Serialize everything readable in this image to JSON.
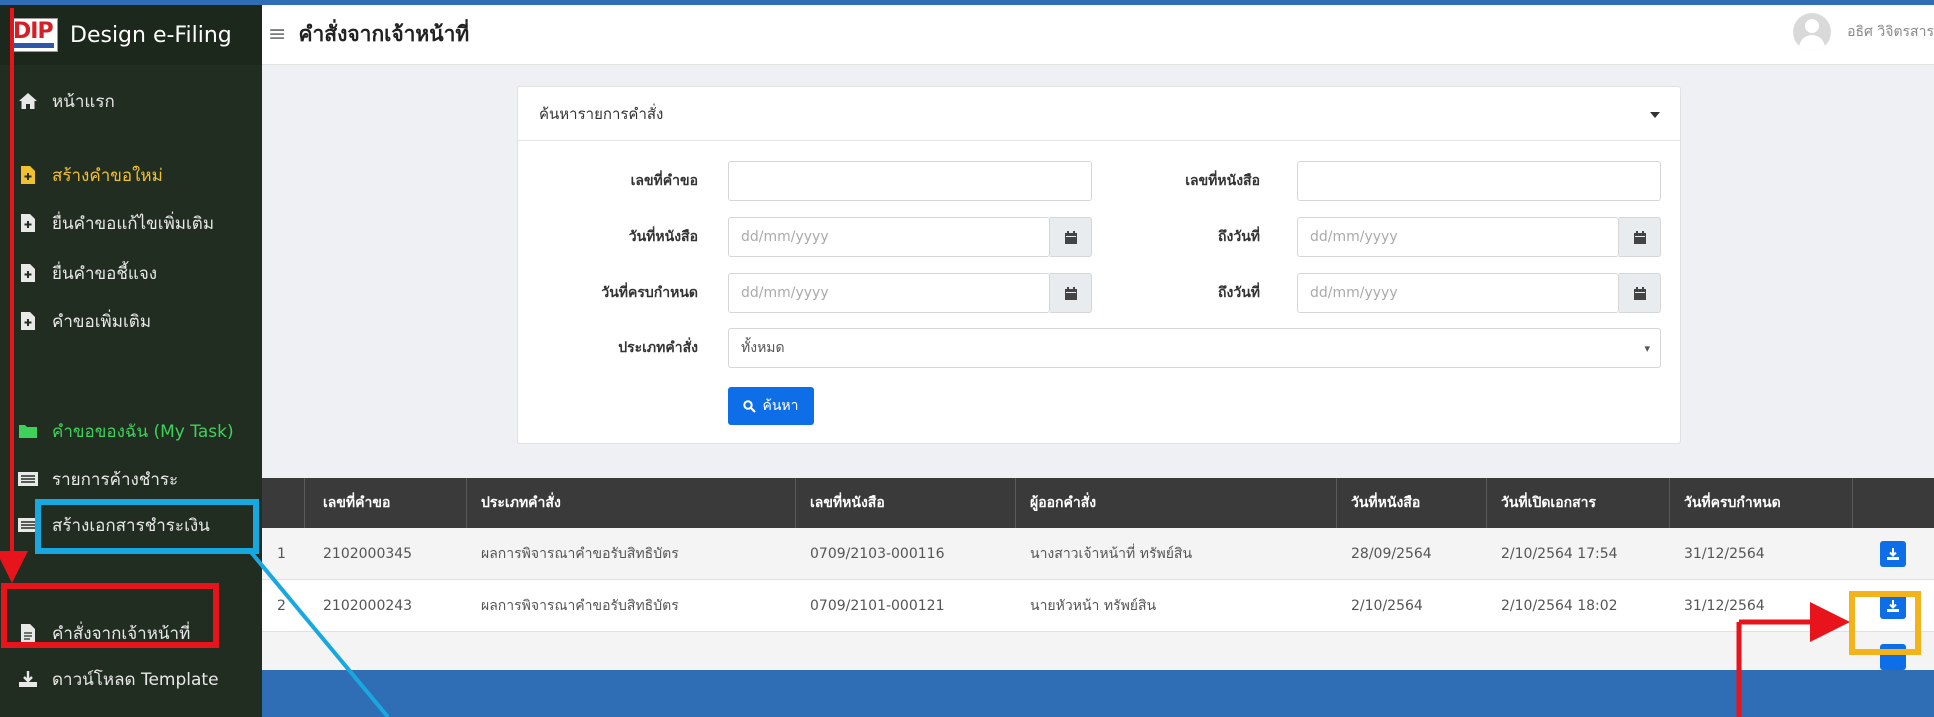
{
  "app": {
    "logo_text": "DIP",
    "title": "Design e-Filing"
  },
  "sidebar": {
    "items": [
      {
        "label": "หน้าแรก",
        "icon": "home-icon"
      },
      {
        "label": "สร้างคำขอใหม่",
        "icon": "file-plus-icon"
      },
      {
        "label": "ยื่นคำขอแก้ไขเพิ่มเติม",
        "icon": "file-plus-icon"
      },
      {
        "label": "ยื่นคำขอชี้แจง",
        "icon": "file-plus-icon"
      },
      {
        "label": "คำขอเพิ่มเติม",
        "icon": "file-plus-icon"
      },
      {
        "label": "คำขอของฉัน (My Task)",
        "icon": "folder-icon"
      },
      {
        "label": "รายการค้างชำระ",
        "icon": "list-icon"
      },
      {
        "label": "สร้างเอกสารชำระเงิน",
        "icon": "list-icon"
      },
      {
        "label": "คำสั่งจากเจ้าหน้าที่",
        "icon": "document-icon"
      },
      {
        "label": "ดาวน์โหลด Template",
        "icon": "download-icon"
      }
    ]
  },
  "header": {
    "title": "คำสั่งจากเจ้าหน้าที่",
    "user_name": "อธิศ วิจิตรสาร"
  },
  "search": {
    "title": "ค้นหารายการคำสั่ง",
    "request_no_label": "เลขที่คำขอ",
    "letter_no_label": "เลขที่หนังสือ",
    "letter_date_label": "วันที่หนังสือ",
    "to_date_label": "ถึงวันที่",
    "due_date_label": "วันที่ครบกำหนด",
    "order_type_label": "ประเภทคำสั่ง",
    "date_placeholder": "dd/mm/yyyy",
    "order_type_value": "ทั้งหมด",
    "search_button": "ค้นหา"
  },
  "table": {
    "headers": [
      "เลขที่คำขอ",
      "ประเภทคำสั่ง",
      "เลขที่หนังสือ",
      "ผู้ออกคำสั่ง",
      "วันที่หนังสือ",
      "วันที่เปิดเอกสาร",
      "วันที่ครบกำหนด"
    ],
    "rows": [
      {
        "no": "1",
        "request_no": "2102000345",
        "order_type": "ผลการพิจารณาคำขอรับสิทธิบัตร",
        "letter_no": "0709/2103-000116",
        "issuer": "นางสาวเจ้าหน้าที่ ทรัพย์สิน",
        "letter_date": "28/09/2564",
        "open_date": "2/10/2564 17:54",
        "due_date": "31/12/2564"
      },
      {
        "no": "2",
        "request_no": "2102000243",
        "order_type": "ผลการพิจารณาคำขอรับสิทธิบัตร",
        "letter_no": "0709/2101-000121",
        "issuer": "นายหัวหน้า ทรัพย์สิน",
        "letter_date": "2/10/2564",
        "open_date": "2/10/2564 18:02",
        "due_date": "31/12/2564"
      }
    ]
  },
  "colors": {
    "sidebar_bg": "#222d22",
    "accent_blue": "#0d6ee8",
    "annotation_red": "#e8141c",
    "annotation_cyan": "#18a8e0",
    "annotation_orange": "#f3b31b",
    "band_blue": "#2f6db5"
  }
}
